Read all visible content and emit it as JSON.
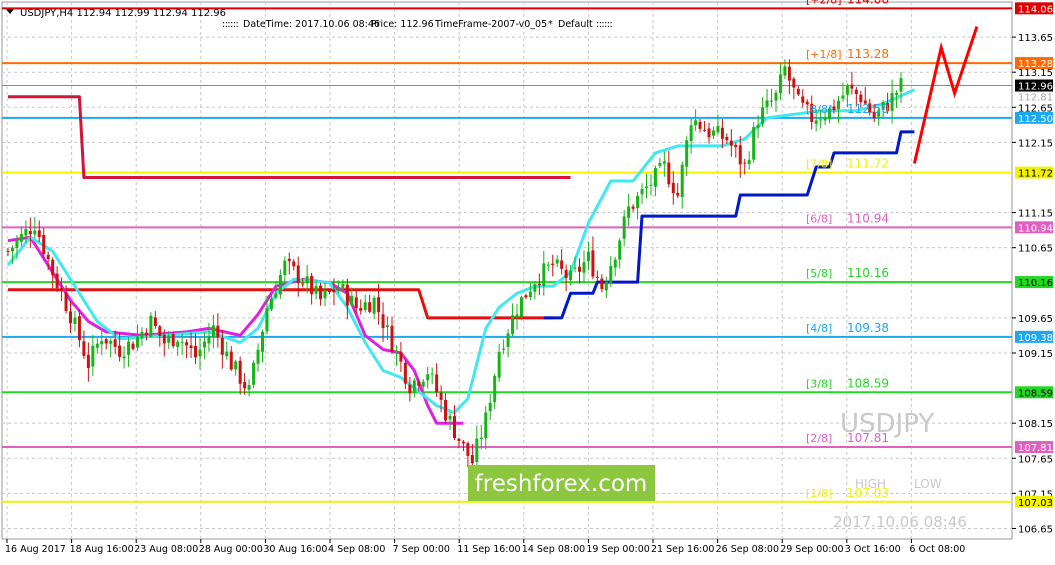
{
  "header": {
    "symbol_info": "USDJPY,H4  112.94 112.99 112.94 112.96",
    "datetime": "DateTime: 2017.10.06 08:46",
    "price": "Price: 112.96",
    "timeframe": "TimeFrame-2007-v0_05",
    "template": "Default"
  },
  "overlay": {
    "symbol_watermark": "USDJPY",
    "brand": "freshforex.com",
    "high_label": "HIGH",
    "low_label": "LOW",
    "timestamp": "2017.10.06 08:46"
  },
  "colors": {
    "background": "#ffffff",
    "grid": "#c8c8c8",
    "bull_candle": "#16b516",
    "bear_candle": "#cc1111",
    "brand_box": "#8dc63f",
    "projection": "#ff0000",
    "ma_red": "#e01010",
    "ma_crimson": "#d4143a",
    "ma_magenta": "#e020e0",
    "ma_cyan": "#40e8f0",
    "ma_navy": "#0018c8",
    "bid_line": "#6f8fb7"
  },
  "chart_data": {
    "type": "candlestick",
    "symbol": "USDJPY",
    "timeframe": "H4",
    "ylim": [
      106.5,
      114.15
    ],
    "grid": true,
    "x_tick_labels": [
      "16 Aug 2017",
      "18 Aug 16:00",
      "23 Aug 08:00",
      "28 Aug 00:00",
      "30 Aug 16:00",
      "4 Sep 08:00",
      "7 Sep 00:00",
      "11 Sep 16:00",
      "14 Sep 08:00",
      "19 Sep 00:00",
      "21 Sep 16:00",
      "26 Sep 08:00",
      "29 Sep 00:00",
      "3 Oct 16:00",
      "6 Oct 08:00"
    ],
    "y_tick_labels": [
      "113.65",
      "113.15",
      "112.65",
      "112.15",
      "111.15",
      "110.65",
      "109.65",
      "109.15",
      "108.15",
      "107.65",
      "107.15",
      "106.65"
    ],
    "current_price": 112.96,
    "secondary_price_label": "112.81",
    "murrey_levels": [
      {
        "label": "[+2/8]",
        "value": 114.06,
        "text": "114.06",
        "tag": "114.06",
        "color": "#e00000"
      },
      {
        "label": "[+1/8]",
        "value": 113.28,
        "text": "113.28",
        "tag": "113.28",
        "color": "#ff6a00"
      },
      {
        "label": "[8/8]",
        "value": 112.5,
        "text": "112.50",
        "tag": "112.50",
        "color": "#1ea8f0"
      },
      {
        "label": "[7/8]",
        "value": 111.72,
        "text": "111.72",
        "tag": "111.72",
        "color": "#f2f200"
      },
      {
        "label": "[6/8]",
        "value": 110.94,
        "text": "110.94",
        "tag": "110.94",
        "color": "#e060c0"
      },
      {
        "label": "[5/8]",
        "value": 110.16,
        "text": "110.16",
        "tag": "110.16",
        "color": "#22d822"
      },
      {
        "label": "[4/8]",
        "value": 109.38,
        "text": "109.38",
        "tag": "109.38",
        "color": "#1ea8f0"
      },
      {
        "label": "[3/8]",
        "value": 108.59,
        "text": "108.59",
        "tag": "108.59",
        "color": "#22d822"
      },
      {
        "label": "[2/8]",
        "value": 107.81,
        "text": "107.81",
        "tag": "107.81",
        "color": "#e060c0"
      },
      {
        "label": "[1/8]",
        "value": 107.03,
        "text": "107.03",
        "tag": "107.03",
        "color": "#f2f200"
      }
    ],
    "anchors": [
      [
        0,
        110.6
      ],
      [
        6,
        111.0
      ],
      [
        10,
        110.3
      ],
      [
        14,
        109.7
      ],
      [
        18,
        109.0
      ],
      [
        21,
        109.4
      ],
      [
        25,
        109.2
      ],
      [
        28,
        109.3
      ],
      [
        32,
        109.6
      ],
      [
        35,
        109.3
      ],
      [
        38,
        109.4
      ],
      [
        42,
        109.1
      ],
      [
        46,
        109.5
      ],
      [
        50,
        109.0
      ],
      [
        54,
        108.6
      ],
      [
        58,
        109.8
      ],
      [
        62,
        110.4
      ],
      [
        66,
        110.2
      ],
      [
        70,
        109.9
      ],
      [
        74,
        110.1
      ],
      [
        78,
        109.8
      ],
      [
        82,
        109.9
      ],
      [
        86,
        109.3
      ],
      [
        90,
        108.7
      ],
      [
        94,
        108.9
      ],
      [
        98,
        108.3
      ],
      [
        102,
        107.8
      ],
      [
        104,
        107.6
      ],
      [
        107,
        108.2
      ],
      [
        110,
        109.2
      ],
      [
        114,
        109.8
      ],
      [
        118,
        110.2
      ],
      [
        122,
        110.4
      ],
      [
        126,
        110.2
      ],
      [
        130,
        110.5
      ],
      [
        133,
        110.1
      ],
      [
        136,
        110.6
      ],
      [
        139,
        111.2
      ],
      [
        143,
        111.5
      ],
      [
        147,
        111.8
      ],
      [
        150,
        111.4
      ],
      [
        153,
        112.5
      ],
      [
        157,
        112.3
      ],
      [
        161,
        112.2
      ],
      [
        165,
        111.8
      ],
      [
        168,
        112.5
      ],
      [
        172,
        112.8
      ],
      [
        174,
        113.2
      ],
      [
        177,
        112.7
      ],
      [
        180,
        112.5
      ],
      [
        184,
        112.6
      ],
      [
        188,
        112.9
      ],
      [
        191,
        112.8
      ],
      [
        194,
        112.5
      ],
      [
        197,
        112.7
      ],
      [
        200,
        112.96
      ]
    ],
    "candle_count": 201,
    "ma_lines": [
      {
        "color": "#d4143a",
        "values": [
          [
            0,
            112.8
          ],
          [
            16,
            112.8
          ],
          [
            17,
            111.65
          ],
          [
            126,
            111.65
          ]
        ]
      },
      {
        "color": "#e01010",
        "values": [
          [
            0,
            110.05
          ],
          [
            92,
            110.05
          ],
          [
            94,
            109.65
          ],
          [
            122,
            109.65
          ]
        ]
      },
      {
        "color": "#e020e0",
        "values": [
          [
            0,
            110.75
          ],
          [
            5,
            110.8
          ],
          [
            10,
            110.3
          ],
          [
            14,
            109.9
          ],
          [
            18,
            109.6
          ],
          [
            22,
            109.45
          ],
          [
            30,
            109.4
          ],
          [
            40,
            109.45
          ],
          [
            45,
            109.5
          ],
          [
            52,
            109.4
          ],
          [
            56,
            109.7
          ],
          [
            60,
            110.1
          ],
          [
            66,
            110.2
          ],
          [
            72,
            110.15
          ],
          [
            76,
            110.0
          ],
          [
            80,
            109.4
          ],
          [
            84,
            109.2
          ],
          [
            88,
            109.15
          ],
          [
            91,
            108.9
          ],
          [
            94,
            108.4
          ],
          [
            96,
            108.15
          ],
          [
            102,
            108.15
          ]
        ]
      },
      {
        "color": "#40e8f0",
        "values": [
          [
            0,
            110.4
          ],
          [
            5,
            110.8
          ],
          [
            10,
            110.6
          ],
          [
            15,
            110.1
          ],
          [
            20,
            109.6
          ],
          [
            25,
            109.35
          ],
          [
            35,
            109.4
          ],
          [
            45,
            109.45
          ],
          [
            52,
            109.3
          ],
          [
            56,
            109.5
          ],
          [
            60,
            110.0
          ],
          [
            64,
            110.2
          ],
          [
            72,
            110.15
          ],
          [
            76,
            109.8
          ],
          [
            80,
            109.3
          ],
          [
            84,
            108.9
          ],
          [
            88,
            108.8
          ],
          [
            92,
            108.6
          ],
          [
            96,
            108.4
          ],
          [
            100,
            108.3
          ],
          [
            103,
            108.5
          ],
          [
            107,
            109.5
          ],
          [
            110,
            109.8
          ],
          [
            114,
            110.0
          ],
          [
            118,
            110.1
          ],
          [
            122,
            110.1
          ],
          [
            126,
            110.3
          ],
          [
            130,
            111.0
          ],
          [
            135,
            111.6
          ],
          [
            140,
            111.6
          ],
          [
            145,
            112.0
          ],
          [
            150,
            112.1
          ],
          [
            155,
            112.1
          ],
          [
            160,
            112.1
          ],
          [
            165,
            112.2
          ],
          [
            170,
            112.5
          ],
          [
            176,
            112.55
          ],
          [
            182,
            112.6
          ],
          [
            190,
            112.6
          ],
          [
            196,
            112.7
          ],
          [
            203,
            112.9
          ]
        ]
      },
      {
        "color": "#0018c8",
        "values": [
          [
            120,
            109.65
          ],
          [
            124,
            109.65
          ],
          [
            126,
            110.0
          ],
          [
            131,
            110.0
          ],
          [
            132,
            110.16
          ],
          [
            141,
            110.16
          ],
          [
            142,
            111.1
          ],
          [
            163,
            111.1
          ],
          [
            164,
            111.4
          ],
          [
            179,
            111.4
          ],
          [
            181,
            111.8
          ],
          [
            184,
            111.8
          ],
          [
            185,
            112.0
          ],
          [
            199,
            112.0
          ],
          [
            200,
            112.3
          ],
          [
            203,
            112.3
          ]
        ]
      }
    ],
    "projection": [
      [
        203,
        111.85
      ],
      [
        209,
        113.5
      ],
      [
        212,
        112.85
      ],
      [
        217,
        113.8
      ]
    ]
  }
}
